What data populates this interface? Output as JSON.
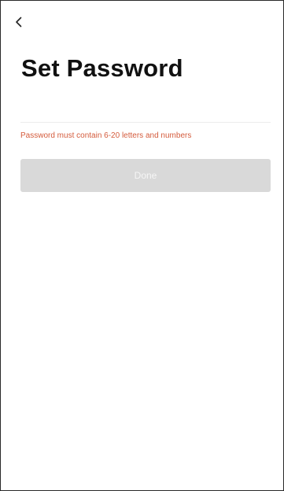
{
  "navigation": {
    "back_icon": "chevron-left-icon"
  },
  "header": {
    "title": "Set Password"
  },
  "form": {
    "password_field": {
      "value": "",
      "placeholder": ""
    },
    "error_message": "Password must contain 6-20 letters and numbers",
    "error_color": "#d45b3c",
    "done_label": "Done",
    "done_disabled_color": "#d9d9d9"
  }
}
